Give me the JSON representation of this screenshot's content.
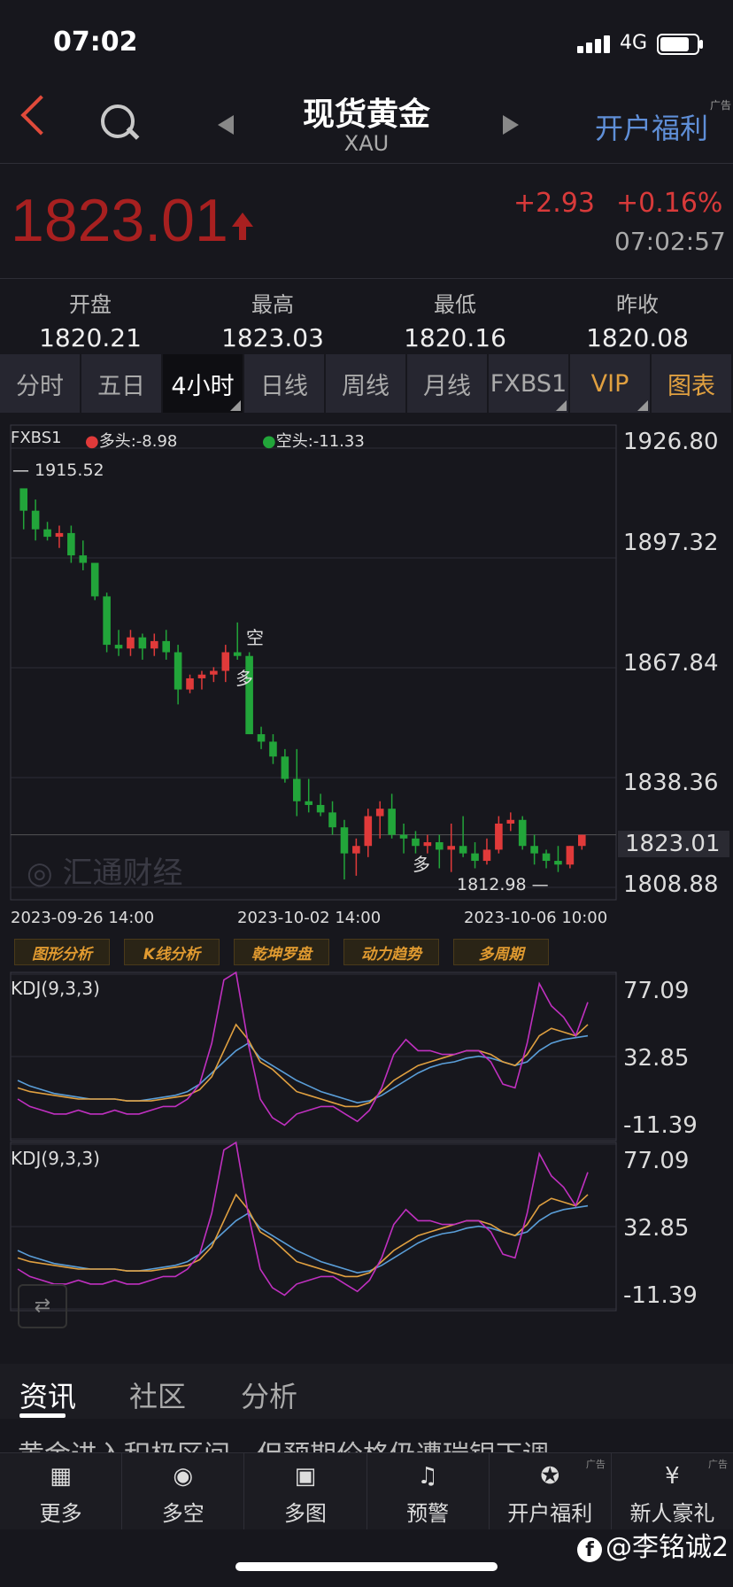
{
  "status": {
    "time": "07:02",
    "network": "4G"
  },
  "header": {
    "title": "现货黄金",
    "symbol": "XAU",
    "promo": "开户福利",
    "ad_tag": "广告"
  },
  "quote": {
    "price": "1823.01",
    "change": "+2.93",
    "change_pct": "+0.16%",
    "time": "07:02:57"
  },
  "stats": [
    {
      "label": "开盘",
      "value": "1820.21"
    },
    {
      "label": "最高",
      "value": "1823.03"
    },
    {
      "label": "最低",
      "value": "1820.16"
    },
    {
      "label": "昨收",
      "value": "1820.08"
    }
  ],
  "tabs": [
    "分时",
    "五日",
    "4小时",
    "日线",
    "周线",
    "月线",
    "FXBS1",
    "VIP",
    "图表"
  ],
  "active_tab": "4小时",
  "colors": {
    "up": "#e03a3a",
    "down": "#22a53a",
    "k": "#5a9ed8",
    "d": "#e0a040",
    "j": "#c030c0",
    "price": "#a82020"
  },
  "main_chart": {
    "indicator": "FXBS1",
    "long_label": "多头:-8.98",
    "short_label": "空头:-11.33",
    "high_mark": "1915.52",
    "low_mark": "1812.98",
    "current": "1823.01",
    "watermark": "汇通财经",
    "signal_short": "空",
    "signal_long": "多",
    "signal_long2": "多",
    "y_ticks": [
      "1926.80",
      "1897.32",
      "1867.84",
      "1838.36",
      "1808.88"
    ],
    "x_ticks": [
      "2023-09-26 14:00",
      "2023-10-02 14:00",
      "2023-10-06 10:00"
    ]
  },
  "chart_data": {
    "type": "candlestick",
    "ylim": [
      1808.88,
      1926.8
    ],
    "candles": [
      [
        1916,
        1914,
        1905,
        1910
      ],
      [
        1910,
        1913,
        1902,
        1905
      ],
      [
        1905,
        1907,
        1902,
        1903
      ],
      [
        1903,
        1906,
        1900,
        1904
      ],
      [
        1904,
        1906,
        1896,
        1898
      ],
      [
        1898,
        1902,
        1894,
        1896
      ],
      [
        1896,
        1895,
        1886,
        1887
      ],
      [
        1887,
        1888,
        1872,
        1874
      ],
      [
        1874,
        1878,
        1871,
        1873
      ],
      [
        1873,
        1878,
        1871,
        1876
      ],
      [
        1876,
        1877,
        1870,
        1873
      ],
      [
        1873,
        1877,
        1871,
        1875
      ],
      [
        1875,
        1878,
        1870,
        1872
      ],
      [
        1872,
        1874,
        1858,
        1862
      ],
      [
        1862,
        1866,
        1861,
        1865
      ],
      [
        1865,
        1867,
        1862,
        1866
      ],
      [
        1866,
        1868,
        1864,
        1867
      ],
      [
        1867,
        1874,
        1864,
        1872
      ],
      [
        1872,
        1880,
        1870,
        1871
      ],
      [
        1871,
        1872,
        1850,
        1850
      ],
      [
        1850,
        1852,
        1846,
        1848
      ],
      [
        1848,
        1850,
        1842,
        1844
      ],
      [
        1844,
        1846,
        1837,
        1838
      ],
      [
        1838,
        1846,
        1828,
        1832
      ],
      [
        1832,
        1838,
        1829,
        1831
      ],
      [
        1831,
        1834,
        1828,
        1829
      ],
      [
        1829,
        1832,
        1823,
        1825
      ],
      [
        1825,
        1827,
        1811,
        1818
      ],
      [
        1818,
        1822,
        1812,
        1820
      ],
      [
        1820,
        1830,
        1817,
        1828
      ],
      [
        1828,
        1832,
        1822,
        1830
      ],
      [
        1830,
        1834,
        1822,
        1823
      ],
      [
        1823,
        1826,
        1818,
        1822
      ],
      [
        1822,
        1824,
        1818,
        1820
      ],
      [
        1820,
        1823,
        1818,
        1821
      ],
      [
        1821,
        1823,
        1814,
        1819
      ],
      [
        1819,
        1826,
        1813,
        1820
      ],
      [
        1820,
        1828,
        1817,
        1818
      ],
      [
        1818,
        1821,
        1814,
        1816
      ],
      [
        1816,
        1822,
        1815,
        1819
      ],
      [
        1819,
        1828,
        1818,
        1826
      ],
      [
        1826,
        1829,
        1824,
        1827
      ],
      [
        1827,
        1828,
        1819,
        1820
      ],
      [
        1820,
        1823,
        1815,
        1818
      ],
      [
        1818,
        1819,
        1814,
        1816
      ],
      [
        1816,
        1820,
        1813,
        1815
      ],
      [
        1815,
        1820,
        1814,
        1820
      ],
      [
        1820,
        1823,
        1819,
        1823
      ]
    ],
    "kdj": {
      "ylim": [
        -11.39,
        77.09
      ],
      "ticks": [
        "77.09",
        "32.85",
        "-11.39"
      ],
      "K": [
        20,
        17,
        15,
        13,
        12,
        11,
        10,
        10,
        10,
        9,
        9,
        10,
        11,
        12,
        14,
        18,
        24,
        30,
        36,
        40,
        32,
        28,
        24,
        20,
        17,
        14,
        12,
        10,
        8,
        9,
        12,
        16,
        20,
        24,
        27,
        29,
        30,
        32,
        33,
        32,
        30,
        28,
        30,
        36,
        40,
        42,
        43,
        44
      ],
      "D": [
        16,
        14,
        13,
        12,
        11,
        10,
        10,
        10,
        10,
        9,
        9,
        9,
        10,
        11,
        12,
        15,
        22,
        36,
        50,
        42,
        30,
        26,
        20,
        14,
        12,
        10,
        8,
        6,
        6,
        8,
        14,
        20,
        24,
        28,
        30,
        32,
        34,
        36,
        36,
        34,
        30,
        28,
        34,
        44,
        48,
        46,
        44,
        50
      ],
      "J": [
        10,
        6,
        4,
        2,
        2,
        4,
        2,
        2,
        4,
        2,
        2,
        4,
        6,
        6,
        10,
        18,
        40,
        74,
        78,
        40,
        10,
        0,
        -4,
        2,
        4,
        6,
        6,
        2,
        -2,
        4,
        16,
        34,
        42,
        36,
        36,
        34,
        34,
        36,
        36,
        30,
        18,
        16,
        40,
        72,
        60,
        54,
        44,
        62
      ]
    }
  },
  "analysis_buttons": [
    "图形分析",
    "K线分析",
    "乾坤罗盘",
    "动力趋势",
    "多周期"
  ],
  "kdj_label": "KDJ(9,3,3)",
  "news": {
    "tabs": [
      "资讯",
      "社区",
      "分析"
    ],
    "active": "资讯",
    "headline": "黄金进入积极区间，但预期价格仍遭瑞银下调"
  },
  "bottom_nav": [
    {
      "label": "更多",
      "icon": "grid-icon"
    },
    {
      "label": "多空",
      "icon": "trend-icon"
    },
    {
      "label": "多图",
      "icon": "multi-chart-icon"
    },
    {
      "label": "预警",
      "icon": "bell-icon"
    },
    {
      "label": "开户福利",
      "icon": "gift-hat-icon",
      "ad": "广告"
    },
    {
      "label": "新人豪礼",
      "icon": "money-bag-icon",
      "ad": "广告"
    }
  ],
  "watermark_user": "@李铭诚2"
}
